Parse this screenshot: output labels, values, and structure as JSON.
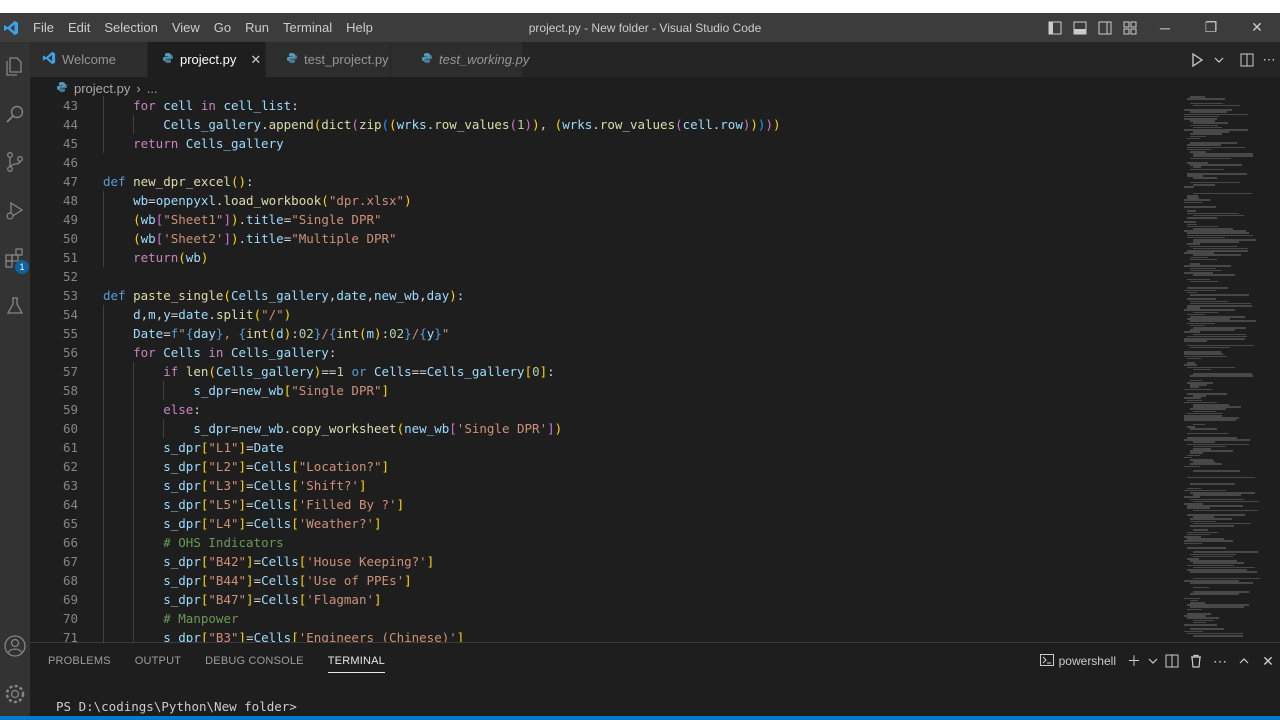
{
  "window": {
    "title": "project.py - New folder - Visual Studio Code",
    "menu": [
      "File",
      "Edit",
      "Selection",
      "View",
      "Go",
      "Run",
      "Terminal",
      "Help"
    ]
  },
  "activity_bar": {
    "items": [
      "explorer-icon",
      "search-icon",
      "source-control-icon",
      "run-debug-icon",
      "extensions-icon",
      "testing-icon"
    ],
    "extensions_badge": "1",
    "bottom": [
      "account-icon",
      "manage-gear-icon"
    ]
  },
  "tabs": [
    {
      "label": "Welcome",
      "icon": "vscode-icon",
      "active": false,
      "italic": false
    },
    {
      "label": "project.py",
      "icon": "python-icon",
      "active": true,
      "italic": false
    },
    {
      "label": "test_project.py",
      "icon": "python-icon",
      "active": false,
      "italic": false
    },
    {
      "label": "test_working.py",
      "icon": "python-icon",
      "active": false,
      "italic": true
    }
  ],
  "tab_close": "✕",
  "breadcrumb": {
    "file": "project.py",
    "sep": "›",
    "rest": "..."
  },
  "editor": {
    "lines": [
      {
        "n": "43",
        "indent": 1,
        "html": "<span class=\"ctl\">for</span> <span class=\"var\">cell</span> <span class=\"ctl\">in</span> <span class=\"var\">cell_list</span>:"
      },
      {
        "n": "44",
        "indent": 2,
        "html": "<span class=\"var\">Cells_gallery</span>.<span class=\"fn\">append</span><span class=\"br1\">(</span><span class=\"fn\">dict</span><span class=\"br2\">(</span><span class=\"fn\">zip</span><span class=\"br3\">(</span><span class=\"br1\">(</span><span class=\"var\">wrks</span>.<span class=\"fn\">row_values</span><span class=\"br2\">(</span><span class=\"num\">1</span><span class=\"br2\">)</span><span class=\"br1\">)</span>, <span class=\"br1\">(</span><span class=\"var\">wrks</span>.<span class=\"fn\">row_values</span><span class=\"br2\">(</span><span class=\"var\">cell</span>.<span class=\"var\">row</span><span class=\"br2\">)</span><span class=\"br1\">)</span><span class=\"br3\">)</span><span class=\"br2\">)</span><span class=\"br1\">)</span>"
      },
      {
        "n": "45",
        "indent": 1,
        "html": "<span class=\"ctl\">return</span> <span class=\"var\">Cells_gallery</span>"
      },
      {
        "n": "46",
        "indent": 0,
        "html": ""
      },
      {
        "n": "47",
        "indent": 0,
        "html": "<span class=\"def\">def</span> <span class=\"fn\">new_dpr_excel</span><span class=\"br1\">()</span>:"
      },
      {
        "n": "48",
        "indent": 1,
        "html": "<span class=\"var\">wb</span>=<span class=\"var\">openpyxl</span>.<span class=\"fn\">load_workbook</span><span class=\"br1\">(</span><span class=\"str\">\"dpr.xlsx\"</span><span class=\"br1\">)</span>"
      },
      {
        "n": "49",
        "indent": 1,
        "html": "<span class=\"br1\">(</span><span class=\"var\">wb</span><span class=\"br2\">[</span><span class=\"str\">\"Sheet1\"</span><span class=\"br2\">]</span><span class=\"br1\">)</span>.<span class=\"var\">title</span>=<span class=\"str\">\"Single DPR\"</span>"
      },
      {
        "n": "50",
        "indent": 1,
        "html": "<span class=\"br1\">(</span><span class=\"var\">wb</span><span class=\"br2\">[</span><span class=\"str\">'Sheet2'</span><span class=\"br2\">]</span><span class=\"br1\">)</span>.<span class=\"var\">title</span>=<span class=\"str\">\"Multiple DPR\"</span>"
      },
      {
        "n": "51",
        "indent": 1,
        "html": "<span class=\"ctl\">return</span><span class=\"br1\">(</span><span class=\"var\">wb</span><span class=\"br1\">)</span>"
      },
      {
        "n": "52",
        "indent": 0,
        "html": ""
      },
      {
        "n": "53",
        "indent": 0,
        "html": "<span class=\"def\">def</span> <span class=\"fn\">paste_single</span><span class=\"br1\">(</span><span class=\"var\">Cells_gallery</span>,<span class=\"var\">date</span>,<span class=\"var\">new_wb</span>,<span class=\"var\">day</span><span class=\"br1\">)</span>:"
      },
      {
        "n": "54",
        "indent": 1,
        "html": "<span class=\"var\">d</span>,<span class=\"var\">m</span>,<span class=\"var\">y</span>=<span class=\"var\">date</span>.<span class=\"fn\">split</span><span class=\"br1\">(</span><span class=\"str\">\"/\"</span><span class=\"br1\">)</span>"
      },
      {
        "n": "55",
        "indent": 1,
        "html": "<span class=\"var\">Date</span>=<span class=\"kw\">f</span><span class=\"str\">\"</span><span class=\"kw\">{</span><span class=\"var\">day</span><span class=\"kw\">}</span><span class=\"str\">, </span><span class=\"kw\">{</span><span class=\"fn\">int</span><span class=\"br1\">(</span><span class=\"var\">d</span><span class=\"br1\">)</span>:<span class=\"num\">02</span><span class=\"kw\">}</span><span class=\"str\">/</span><span class=\"kw\">{</span><span class=\"fn\">int</span><span class=\"br1\">(</span><span class=\"var\">m</span><span class=\"br1\">)</span>:<span class=\"num\">02</span><span class=\"kw\">}</span><span class=\"str\">/</span><span class=\"kw\">{</span><span class=\"var\">y</span><span class=\"kw\">}</span><span class=\"str\">\"</span>"
      },
      {
        "n": "56",
        "indent": 1,
        "html": "<span class=\"ctl\">for</span> <span class=\"var\">Cells</span> <span class=\"ctl\">in</span> <span class=\"var\">Cells_gallery</span>:"
      },
      {
        "n": "57",
        "indent": 2,
        "html": "<span class=\"ctl\">if</span> <span class=\"fn\">len</span><span class=\"br1\">(</span><span class=\"var\">Cells_gallery</span><span class=\"br1\">)</span>==<span class=\"num\">1</span> <span class=\"kw\">or</span> <span class=\"var\">Cells</span>==<span class=\"var\">Cells_gallery</span><span class=\"br1\">[</span><span class=\"num\">0</span><span class=\"br1\">]</span>:"
      },
      {
        "n": "58",
        "indent": 3,
        "html": "<span class=\"var\">s_dpr</span>=<span class=\"var\">new_wb</span><span class=\"br1\">[</span><span class=\"str\">\"Single DPR\"</span><span class=\"br1\">]</span>"
      },
      {
        "n": "59",
        "indent": 2,
        "html": "<span class=\"ctl\">else</span>:"
      },
      {
        "n": "60",
        "indent": 3,
        "html": "<span class=\"var\">s_dpr</span>=<span class=\"var\">new_wb</span>.<span class=\"fn\">copy_worksheet</span><span class=\"br1\">(</span><span class=\"var\">new_wb</span><span class=\"br2\">[</span><span class=\"str\">'Single DPR'</span><span class=\"br2\">]</span><span class=\"br1\">)</span>"
      },
      {
        "n": "61",
        "indent": 2,
        "html": "<span class=\"var\">s_dpr</span><span class=\"br1\">[</span><span class=\"str\">\"L1\"</span><span class=\"br1\">]</span>=<span class=\"var\">Date</span>"
      },
      {
        "n": "62",
        "indent": 2,
        "html": "<span class=\"var\">s_dpr</span><span class=\"br1\">[</span><span class=\"str\">\"L2\"</span><span class=\"br1\">]</span>=<span class=\"var\">Cells</span><span class=\"br1\">[</span><span class=\"str\">\"Location?\"</span><span class=\"br1\">]</span>"
      },
      {
        "n": "63",
        "indent": 2,
        "html": "<span class=\"var\">s_dpr</span><span class=\"br1\">[</span><span class=\"str\">\"L3\"</span><span class=\"br1\">]</span>=<span class=\"var\">Cells</span><span class=\"br1\">[</span><span class=\"str\">'Shift?'</span><span class=\"br1\">]</span>"
      },
      {
        "n": "64",
        "indent": 2,
        "html": "<span class=\"var\">s_dpr</span><span class=\"br1\">[</span><span class=\"str\">\"L5\"</span><span class=\"br1\">]</span>=<span class=\"var\">Cells</span><span class=\"br1\">[</span><span class=\"str\">'Filled By ?'</span><span class=\"br1\">]</span>"
      },
      {
        "n": "65",
        "indent": 2,
        "html": "<span class=\"var\">s_dpr</span><span class=\"br1\">[</span><span class=\"str\">\"L4\"</span><span class=\"br1\">]</span>=<span class=\"var\">Cells</span><span class=\"br1\">[</span><span class=\"str\">'Weather?'</span><span class=\"br1\">]</span>"
      },
      {
        "n": "66",
        "indent": 2,
        "html": "<span class=\"cmt\"># OHS Indicators</span>"
      },
      {
        "n": "67",
        "indent": 2,
        "html": "<span class=\"var\">s_dpr</span><span class=\"br1\">[</span><span class=\"str\">\"B42\"</span><span class=\"br1\">]</span>=<span class=\"var\">Cells</span><span class=\"br1\">[</span><span class=\"str\">'House Keeping?'</span><span class=\"br1\">]</span>"
      },
      {
        "n": "68",
        "indent": 2,
        "html": "<span class=\"var\">s_dpr</span><span class=\"br1\">[</span><span class=\"str\">\"B44\"</span><span class=\"br1\">]</span>=<span class=\"var\">Cells</span><span class=\"br1\">[</span><span class=\"str\">'Use of PPEs'</span><span class=\"br1\">]</span>"
      },
      {
        "n": "69",
        "indent": 2,
        "html": "<span class=\"var\">s_dpr</span><span class=\"br1\">[</span><span class=\"str\">\"B47\"</span><span class=\"br1\">]</span>=<span class=\"var\">Cells</span><span class=\"br1\">[</span><span class=\"str\">'Flagman'</span><span class=\"br1\">]</span>"
      },
      {
        "n": "70",
        "indent": 2,
        "html": "<span class=\"cmt\"># Manpower</span>"
      },
      {
        "n": "71",
        "indent": 2,
        "html": "<span class=\"var\">s_dpr</span><span class=\"br1\">[</span><span class=\"str\">\"B3\"</span><span class=\"br1\">]</span>=<span class=\"var\">Cells</span><span class=\"br1\">[</span><span class=\"str\">'Engineers (Chinese)'</span><span class=\"br1\">]</span>"
      }
    ]
  },
  "panel": {
    "tabs": [
      "PROBLEMS",
      "OUTPUT",
      "DEBUG CONSOLE",
      "TERMINAL"
    ],
    "active_tab": "TERMINAL",
    "shell": "powershell",
    "prompt": "PS D:\\codings\\Python\\New folder>"
  }
}
